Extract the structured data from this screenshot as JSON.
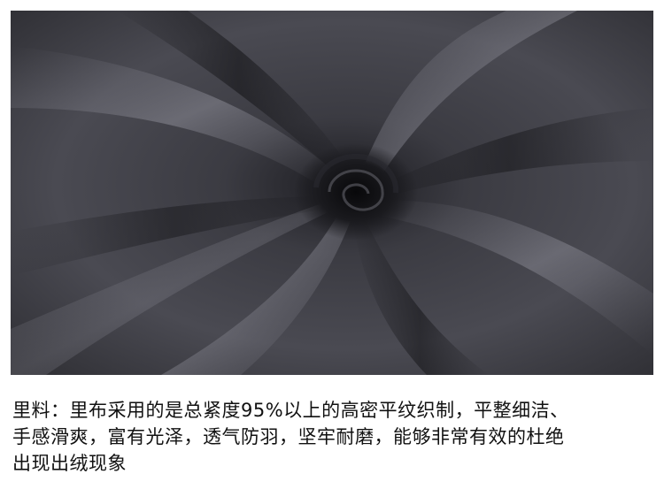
{
  "image": {
    "subject": "fabric-swirl-icon"
  },
  "caption": {
    "lines": [
      "里料：里布采用的是总紧度95%以上的高密平纹织制，平整细洁、",
      "手感滑爽，富有光泽，透气防羽，坚牢耐磨，能够非常有效的杜绝",
      "出现出绒现象"
    ]
  }
}
